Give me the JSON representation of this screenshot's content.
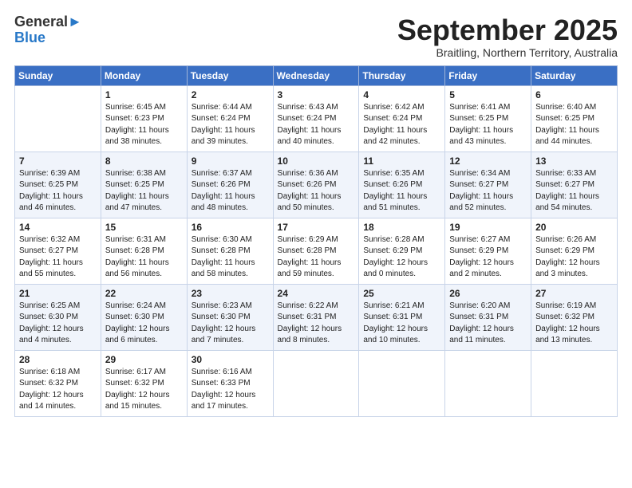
{
  "header": {
    "logo_line1": "General",
    "logo_line2": "Blue",
    "title": "September 2025",
    "subtitle": "Braitling, Northern Territory, Australia"
  },
  "days_of_week": [
    "Sunday",
    "Monday",
    "Tuesday",
    "Wednesday",
    "Thursday",
    "Friday",
    "Saturday"
  ],
  "weeks": [
    [
      {
        "day": "",
        "info": ""
      },
      {
        "day": "1",
        "info": "Sunrise: 6:45 AM\nSunset: 6:23 PM\nDaylight: 11 hours\nand 38 minutes."
      },
      {
        "day": "2",
        "info": "Sunrise: 6:44 AM\nSunset: 6:24 PM\nDaylight: 11 hours\nand 39 minutes."
      },
      {
        "day": "3",
        "info": "Sunrise: 6:43 AM\nSunset: 6:24 PM\nDaylight: 11 hours\nand 40 minutes."
      },
      {
        "day": "4",
        "info": "Sunrise: 6:42 AM\nSunset: 6:24 PM\nDaylight: 11 hours\nand 42 minutes."
      },
      {
        "day": "5",
        "info": "Sunrise: 6:41 AM\nSunset: 6:25 PM\nDaylight: 11 hours\nand 43 minutes."
      },
      {
        "day": "6",
        "info": "Sunrise: 6:40 AM\nSunset: 6:25 PM\nDaylight: 11 hours\nand 44 minutes."
      }
    ],
    [
      {
        "day": "7",
        "info": "Sunrise: 6:39 AM\nSunset: 6:25 PM\nDaylight: 11 hours\nand 46 minutes."
      },
      {
        "day": "8",
        "info": "Sunrise: 6:38 AM\nSunset: 6:25 PM\nDaylight: 11 hours\nand 47 minutes."
      },
      {
        "day": "9",
        "info": "Sunrise: 6:37 AM\nSunset: 6:26 PM\nDaylight: 11 hours\nand 48 minutes."
      },
      {
        "day": "10",
        "info": "Sunrise: 6:36 AM\nSunset: 6:26 PM\nDaylight: 11 hours\nand 50 minutes."
      },
      {
        "day": "11",
        "info": "Sunrise: 6:35 AM\nSunset: 6:26 PM\nDaylight: 11 hours\nand 51 minutes."
      },
      {
        "day": "12",
        "info": "Sunrise: 6:34 AM\nSunset: 6:27 PM\nDaylight: 11 hours\nand 52 minutes."
      },
      {
        "day": "13",
        "info": "Sunrise: 6:33 AM\nSunset: 6:27 PM\nDaylight: 11 hours\nand 54 minutes."
      }
    ],
    [
      {
        "day": "14",
        "info": "Sunrise: 6:32 AM\nSunset: 6:27 PM\nDaylight: 11 hours\nand 55 minutes."
      },
      {
        "day": "15",
        "info": "Sunrise: 6:31 AM\nSunset: 6:28 PM\nDaylight: 11 hours\nand 56 minutes."
      },
      {
        "day": "16",
        "info": "Sunrise: 6:30 AM\nSunset: 6:28 PM\nDaylight: 11 hours\nand 58 minutes."
      },
      {
        "day": "17",
        "info": "Sunrise: 6:29 AM\nSunset: 6:28 PM\nDaylight: 11 hours\nand 59 minutes."
      },
      {
        "day": "18",
        "info": "Sunrise: 6:28 AM\nSunset: 6:29 PM\nDaylight: 12 hours\nand 0 minutes."
      },
      {
        "day": "19",
        "info": "Sunrise: 6:27 AM\nSunset: 6:29 PM\nDaylight: 12 hours\nand 2 minutes."
      },
      {
        "day": "20",
        "info": "Sunrise: 6:26 AM\nSunset: 6:29 PM\nDaylight: 12 hours\nand 3 minutes."
      }
    ],
    [
      {
        "day": "21",
        "info": "Sunrise: 6:25 AM\nSunset: 6:30 PM\nDaylight: 12 hours\nand 4 minutes."
      },
      {
        "day": "22",
        "info": "Sunrise: 6:24 AM\nSunset: 6:30 PM\nDaylight: 12 hours\nand 6 minutes."
      },
      {
        "day": "23",
        "info": "Sunrise: 6:23 AM\nSunset: 6:30 PM\nDaylight: 12 hours\nand 7 minutes."
      },
      {
        "day": "24",
        "info": "Sunrise: 6:22 AM\nSunset: 6:31 PM\nDaylight: 12 hours\nand 8 minutes."
      },
      {
        "day": "25",
        "info": "Sunrise: 6:21 AM\nSunset: 6:31 PM\nDaylight: 12 hours\nand 10 minutes."
      },
      {
        "day": "26",
        "info": "Sunrise: 6:20 AM\nSunset: 6:31 PM\nDaylight: 12 hours\nand 11 minutes."
      },
      {
        "day": "27",
        "info": "Sunrise: 6:19 AM\nSunset: 6:32 PM\nDaylight: 12 hours\nand 13 minutes."
      }
    ],
    [
      {
        "day": "28",
        "info": "Sunrise: 6:18 AM\nSunset: 6:32 PM\nDaylight: 12 hours\nand 14 minutes."
      },
      {
        "day": "29",
        "info": "Sunrise: 6:17 AM\nSunset: 6:32 PM\nDaylight: 12 hours\nand 15 minutes."
      },
      {
        "day": "30",
        "info": "Sunrise: 6:16 AM\nSunset: 6:33 PM\nDaylight: 12 hours\nand 17 minutes."
      },
      {
        "day": "",
        "info": ""
      },
      {
        "day": "",
        "info": ""
      },
      {
        "day": "",
        "info": ""
      },
      {
        "day": "",
        "info": ""
      }
    ]
  ]
}
